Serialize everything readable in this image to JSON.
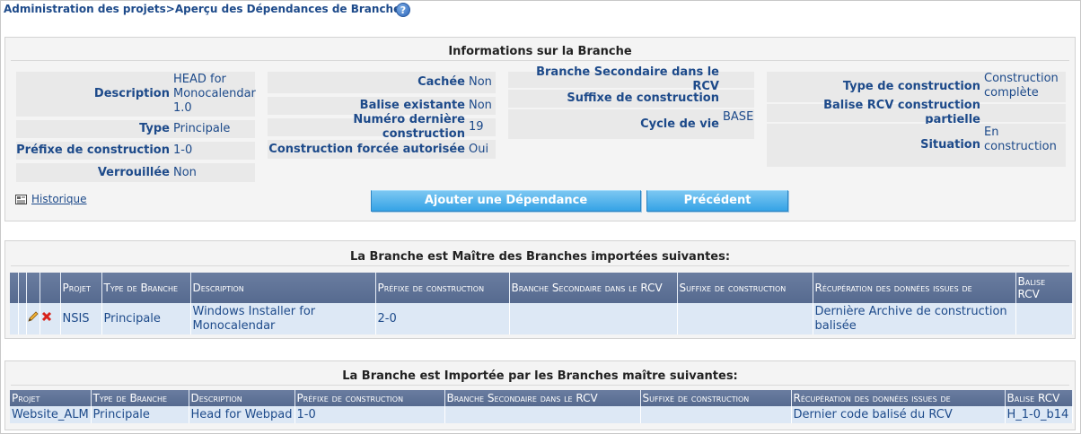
{
  "breadcrumb": "Administration des projets>Aperçu des Dépendances de Branche",
  "help_icon": "?",
  "info": {
    "title": "Informations sur la Branche",
    "description_label": "Description",
    "description_value": "HEAD for Monocalendar 1.0",
    "type_label": "Type",
    "type_value": "Principale",
    "prefix_label": "Préfixe de construction",
    "prefix_value": "1-0",
    "locked_label": "Verrouillée",
    "locked_value": "Non",
    "hidden_label": "Cachée",
    "hidden_value": "Non",
    "tag_label": "Balise existante",
    "tag_value": "Non",
    "lastbuild_label": "Numéro dernière construction",
    "lastbuild_value": "19",
    "forced_label": "Construction forcée autorisée",
    "forced_value": "Oui",
    "vcs_branch_label": "Branche Secondaire dans le RCV",
    "vcs_branch_value": "",
    "suffix_label": "Suffixe de construction",
    "suffix_value": "",
    "lifecycle_label": "Cycle de vie",
    "lifecycle_value": "BASE",
    "buildtype_label": "Type de construction",
    "buildtype_value": "Construction complète",
    "partial_tag_label": "Balise RCV construction partielle",
    "partial_tag_value": "",
    "status_label": "Situation",
    "status_value": "En construction",
    "history_link": "Historique",
    "add_dependency_button": "Ajouter une Dépendance",
    "previous_button": "Précédent"
  },
  "master": {
    "title": "La Branche est Maître des Branches importées suivantes:",
    "headers": [
      "Projet",
      "Type de Branche",
      "Description",
      "Préfixe de construction",
      "Branche Secondaire dans le RCV",
      "Suffixe de construction",
      "Récupération des données issues de",
      "Balise RCV"
    ],
    "rows": [
      {
        "project": "NSIS",
        "type": "Principale",
        "description": "Windows Installer for Monocalendar",
        "prefix": "2-0",
        "vcs_branch": "",
        "suffix": "",
        "retrieval": "Dernière Archive de construction balisée",
        "tag": ""
      }
    ]
  },
  "imported": {
    "title": "La Branche est Importée par les Branches maître suivantes:",
    "headers": [
      "Projet",
      "Type de Branche",
      "Description",
      "Préfixe de construction",
      "Branche Secondaire dans le RCV",
      "Suffixe de construction",
      "Récupération des données issues de",
      "Balise RCV"
    ],
    "rows": [
      {
        "project": "Website_ALM",
        "type": "Principale",
        "description": "Head for Webpad",
        "prefix": "1-0",
        "vcs_branch": "",
        "suffix": "",
        "retrieval": "Dernier code balisé du RCV",
        "tag": "H_1-0_b14"
      }
    ]
  }
}
